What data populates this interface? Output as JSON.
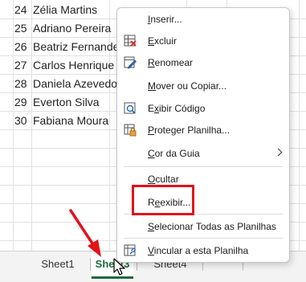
{
  "rows": [
    {
      "num": "24",
      "name": "Zélia Martins"
    },
    {
      "num": "25",
      "name": "Adriano Pereira"
    },
    {
      "num": "26",
      "name": "Beatriz Fernande"
    },
    {
      "num": "27",
      "name": "Carlos Henrique"
    },
    {
      "num": "28",
      "name": "Daniela Azevedo"
    },
    {
      "num": "29",
      "name": "Everton Silva"
    },
    {
      "num": "30",
      "name": "Fabiana Moura"
    }
  ],
  "menu": {
    "inserir": {
      "pre": "",
      "u": "I",
      "post": "nserir..."
    },
    "excluir": {
      "pre": "",
      "u": "E",
      "post": "xcluir"
    },
    "renomear": {
      "pre": "",
      "u": "R",
      "post": "enomear"
    },
    "mover": {
      "pre": "",
      "u": "M",
      "post": "over ou Copiar..."
    },
    "exibir_codigo": {
      "pre": "E",
      "u": "x",
      "post": "ibir Código"
    },
    "proteger": {
      "pre": "",
      "u": "P",
      "post": "roteger Planilha..."
    },
    "cor_guia": {
      "pre": "",
      "u": "C",
      "post": "or da Guia"
    },
    "ocultar": {
      "pre": "",
      "u": "O",
      "post": "cultar"
    },
    "reexibir": {
      "pre": "R",
      "u": "e",
      "post": "exibir..."
    },
    "selecionar": {
      "pre": "",
      "u": "S",
      "post": "elecionar Todas as Planilhas"
    },
    "vincular": {
      "pre": "",
      "u": "V",
      "post": "incular a esta Planilha"
    }
  },
  "tabs": {
    "sheet1": "Sheet1",
    "sheet3": "Sheet3",
    "sheet4": "Sheet4"
  },
  "colors": {
    "highlight_red": "#e3121b",
    "active_tab_green": "#1e6b3a"
  }
}
